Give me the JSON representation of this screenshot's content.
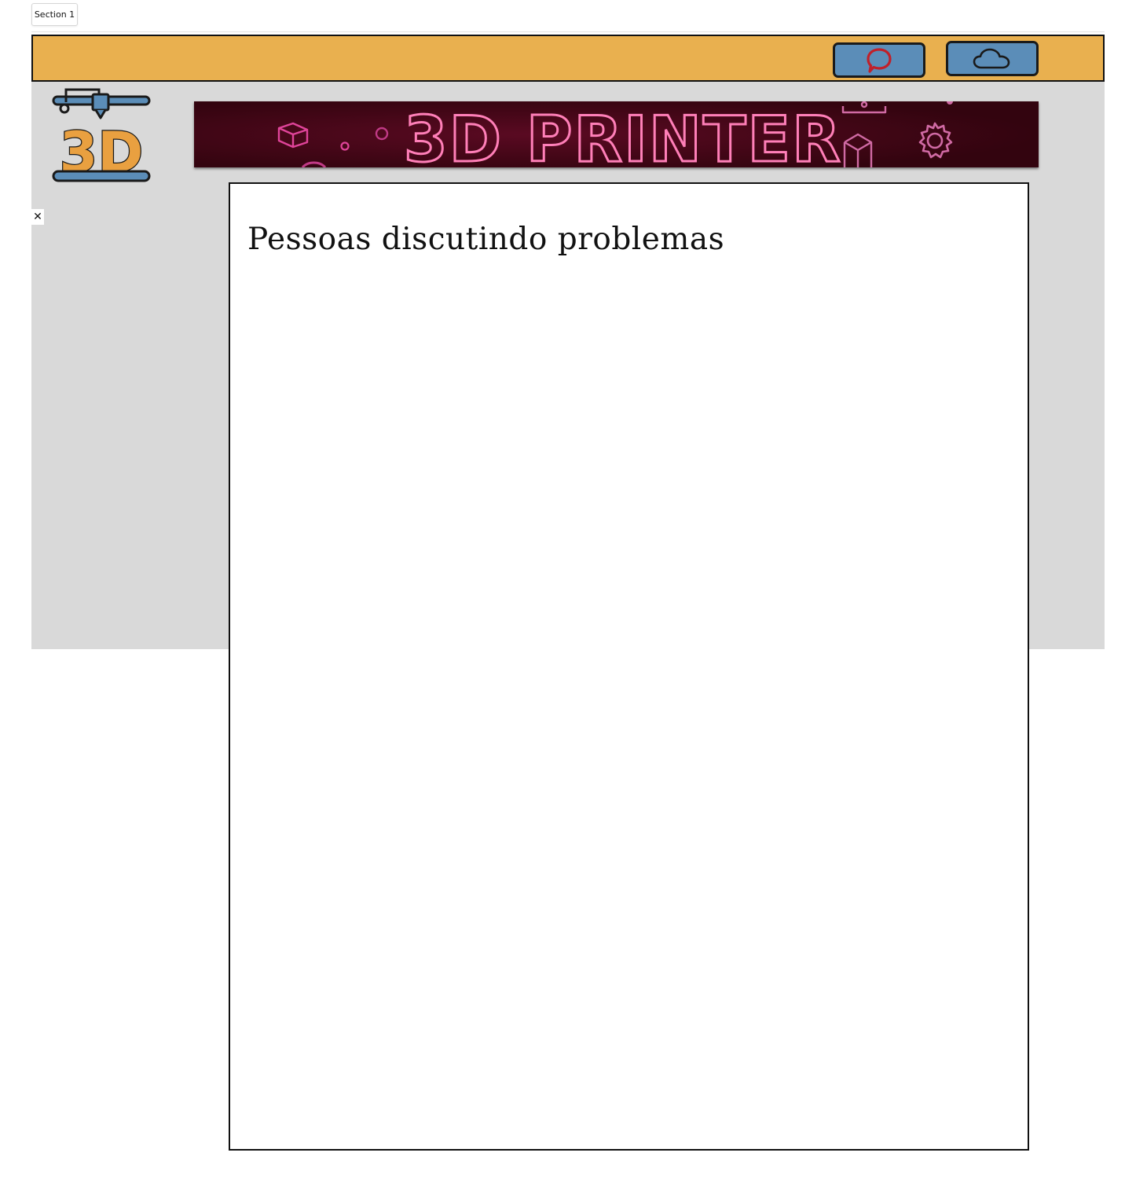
{
  "tabs": {
    "section_label": "Section 1"
  },
  "header": {
    "chat_button_icon": "chat-bubble-icon",
    "cloud_button_icon": "cloud-icon"
  },
  "logo": {
    "icon": "3d-printer-logo-icon",
    "text": "3D"
  },
  "banner": {
    "title": "3D PRINTER"
  },
  "panel": {
    "close_icon": "close-icon",
    "close_glyph": "✕",
    "title": "Pessoas discutindo problemas"
  },
  "colors": {
    "topbar": "#e9b04f",
    "button": "#5b8db8",
    "canvas": "#d9d9d9",
    "banner_bg": "#3a0612",
    "banner_neon": "#e0449a",
    "chat_icon": "#c0202a"
  }
}
